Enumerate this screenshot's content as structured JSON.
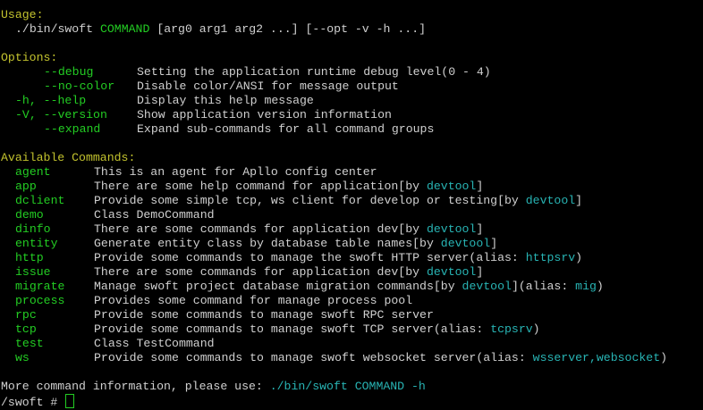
{
  "usage": {
    "heading": "Usage:",
    "script": "./bin/swoft",
    "command": "COMMAND",
    "args": "[arg0 arg1 arg2 ...] [--opt -v -h ...]"
  },
  "options": {
    "heading": "Options:",
    "items": [
      {
        "flag": "--debug",
        "desc": "Setting the application runtime debug level(0 - 4)"
      },
      {
        "flag": "--no-color",
        "desc": "Disable color/ANSI for message output"
      },
      {
        "flag": "-h, --help",
        "desc": "Display this help message"
      },
      {
        "flag": "-V, --version",
        "desc": "Show application version information"
      },
      {
        "flag": "--expand",
        "desc": "Expand sub-commands for all command groups"
      }
    ]
  },
  "commands": {
    "heading": "Available Commands:",
    "items": [
      {
        "name": "agent",
        "desc": "This is an agent for Apllo config center"
      },
      {
        "name": "app",
        "desc": "There are some help command for application[by ",
        "hl": "devtool",
        "tail": "]"
      },
      {
        "name": "dclient",
        "desc": "Provide some simple tcp, ws client for develop or testing[by ",
        "hl": "devtool",
        "tail": "]"
      },
      {
        "name": "demo",
        "desc": "Class DemoCommand"
      },
      {
        "name": "dinfo",
        "desc": "There are some commands for application dev[by ",
        "hl": "devtool",
        "tail": "]"
      },
      {
        "name": "entity",
        "desc": "Generate entity class by database table names[by ",
        "hl": "devtool",
        "tail": "]"
      },
      {
        "name": "http",
        "desc": "Provide some commands to manage the swoft HTTP server(alias: ",
        "hl": "httpsrv",
        "tail": ")"
      },
      {
        "name": "issue",
        "desc": "There are some commands for application dev[by ",
        "hl": "devtool",
        "tail": "]"
      },
      {
        "name": "migrate",
        "desc": "Manage swoft project database migration commands[by ",
        "hl": "devtool",
        "mid": "](alias: ",
        "hl2": "mig",
        "tail": ")"
      },
      {
        "name": "process",
        "desc": "Provides some command for manage process pool"
      },
      {
        "name": "rpc",
        "desc": "Provide some commands to manage swoft RPC server"
      },
      {
        "name": "tcp",
        "desc": "Provide some commands to manage swoft TCP server(alias: ",
        "hl": "tcpsrv",
        "tail": ")"
      },
      {
        "name": "test",
        "desc": "Class TestCommand"
      },
      {
        "name": "ws",
        "desc": "Provide some commands to manage swoft websocket server(alias: ",
        "hl": "wsserver,websocket",
        "tail": ")"
      }
    ]
  },
  "footer": {
    "info": "More command information, please use: ",
    "info_cmd": "./bin/swoft COMMAND -h",
    "prompt": "/swoft # "
  },
  "colors": {
    "background": "#000000",
    "heading": "#c3c32e",
    "name": "#23cd23",
    "highlight": "#28b4b4",
    "text": "#d0d0d0"
  }
}
